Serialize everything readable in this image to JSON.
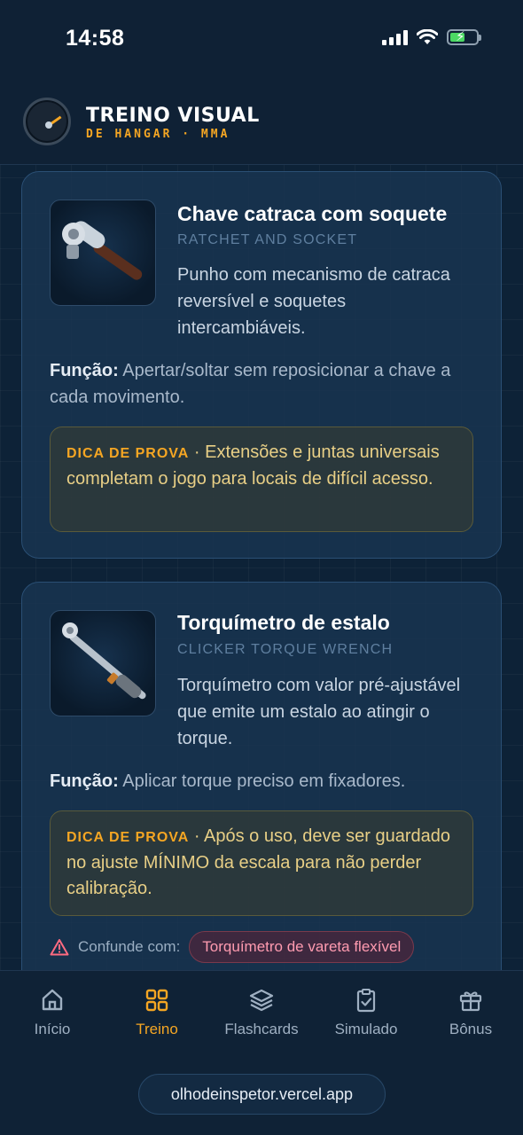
{
  "status_bar": {
    "time": "14:58",
    "battery_level": 0.58
  },
  "header": {
    "title": "TREINO VISUAL",
    "subtitle": "DE HANGAR · MMA",
    "logo_icon": "gauge-icon"
  },
  "cards": [
    {
      "title": "Chave catraca com soquete",
      "subtitle_en": "RATCHET AND SOCKET",
      "description": "Punho com mecanismo de catraca reversível e soquetes intercambiáveis.",
      "funcao_label": "Função:",
      "funcao_text": "Apertar/soltar sem reposicionar a chave a cada movimento.",
      "tip_label": "DICA DE PROVA",
      "tip_text": "· Extensões e juntas universais completam o jogo para locais de difícil acesso.",
      "image_icon": "ratchet-icon"
    },
    {
      "title": "Torquímetro de estalo",
      "subtitle_en": "CLICKER TORQUE WRENCH",
      "description": "Torquímetro com valor pré-ajustável que emite um estalo ao atingir o torque.",
      "funcao_label": "Função:",
      "funcao_text": "Aplicar torque preciso em fixadores.",
      "tip_label": "DICA DE PROVA",
      "tip_text": "· Após o uso, deve ser guardado no ajuste MÍNIMO da escala para não perder calibração.",
      "confuse_label": "Confunde com:",
      "confuse_chip": "Torquímetro de vareta flexível",
      "image_icon": "torque-wrench-icon"
    }
  ],
  "nav": {
    "items": [
      {
        "label": "Início",
        "icon": "home-icon",
        "active": false
      },
      {
        "label": "Treino",
        "icon": "grid-icon",
        "active": true
      },
      {
        "label": "Flashcards",
        "icon": "layers-icon",
        "active": false
      },
      {
        "label": "Simulado",
        "icon": "clipboard-check-icon",
        "active": false
      },
      {
        "label": "Bônus",
        "icon": "gift-icon",
        "active": false
      }
    ]
  },
  "browser": {
    "url": "olhodeinspetor.vercel.app"
  },
  "colors": {
    "accent": "#f5a623",
    "background": "#0d2237",
    "card": "#183450",
    "danger": "#ff9bb0"
  }
}
